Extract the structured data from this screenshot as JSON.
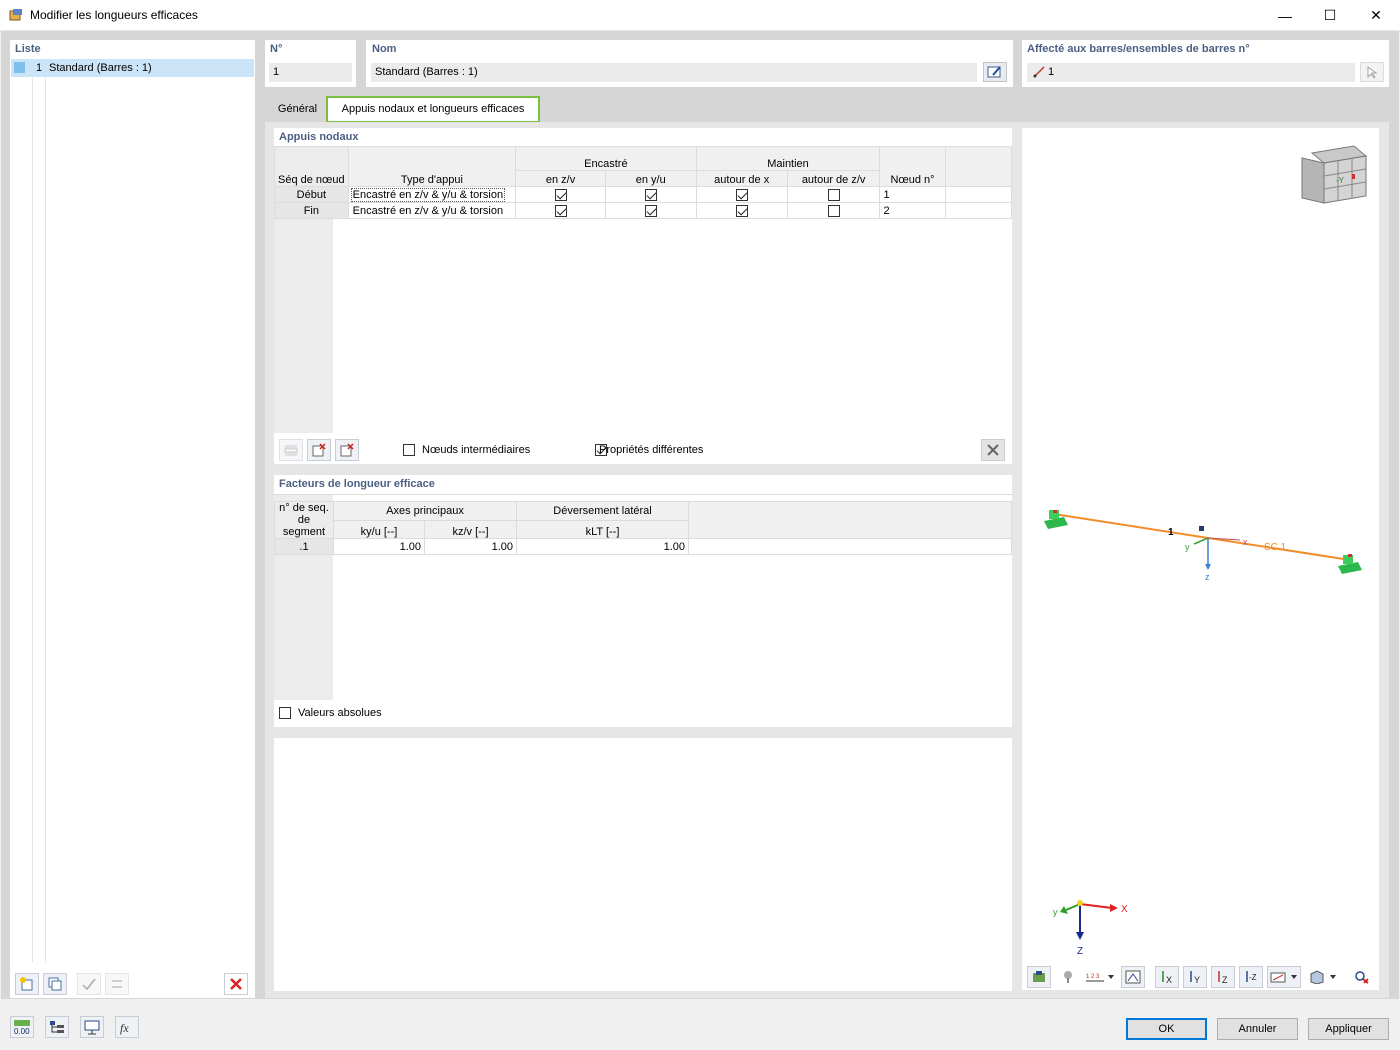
{
  "window": {
    "title": "Modifier les longueurs efficaces",
    "minimize_glyph": "—",
    "maximize_glyph": "☐",
    "close_glyph": "✕"
  },
  "list": {
    "header": "Liste",
    "items": [
      {
        "number": "1",
        "label": "Standard (Barres : 1)"
      }
    ]
  },
  "fields": {
    "no_label": "N°",
    "no_value": "1",
    "name_label": "Nom",
    "name_value": "Standard (Barres : 1)",
    "assigned_label": "Affecté aux barres/ensembles de barres n°",
    "assigned_value": "1"
  },
  "tabs": [
    {
      "label": "Général",
      "active": false
    },
    {
      "label": "Appuis nodaux et longueurs efficaces",
      "active": true
    }
  ],
  "nodal_supports": {
    "title": "Appuis nodaux",
    "headers": {
      "seq": "Séq de nœud",
      "type": "Type d'appui",
      "fixed": "Encastré",
      "fixed_zv": "en z/v",
      "fixed_yu": "en y/u",
      "restraint": "Maintien",
      "about_x": "autour de x",
      "about_zv": "autour de z/v",
      "node": "Nœud n°"
    },
    "rows": [
      {
        "seq": "Début",
        "type": "Encastré en z/v & y/u & torsion",
        "node": "1"
      },
      {
        "seq": "Fin",
        "type": "Encastré en z/v & y/u & torsion",
        "node": "2"
      }
    ],
    "intermediate_nodes_label": "Nœuds intermédiaires",
    "intermediate_nodes_checked": false,
    "different_props_label": "Propriétés différentes",
    "different_props_checked": true
  },
  "effective_length": {
    "title": "Facteurs de longueur efficace",
    "headers": {
      "seg": "n° de seq. de segment",
      "principal": "Axes principaux",
      "kyu": "ky/u [--]",
      "kzv": "kz/v [--]",
      "lt": "Déversement latéral",
      "klt": "kLT [--]"
    },
    "rows": [
      {
        "seg": ".1",
        "kyu": "1.00",
        "kzv": "1.00",
        "klt": "1.00"
      }
    ],
    "absolute_label": "Valeurs absolues"
  },
  "view3d": {
    "member_label": "1",
    "sc_label": "SC 1",
    "axis_x": "x",
    "axis_y": "y",
    "axis_z": "z",
    "gizmo_x": "X",
    "gizmo_y": "y",
    "gizmo_z": "Z",
    "cube_face": "-Y"
  },
  "footer": {
    "ok": "OK",
    "cancel": "Annuler",
    "apply": "Appliquer",
    "units_icon_text": "0.00"
  },
  "colors": {
    "accent_tab_border": "#7ac142",
    "member_line": "#f28c28",
    "support_green": "#2db84d",
    "header_text": "#4b5f83"
  }
}
